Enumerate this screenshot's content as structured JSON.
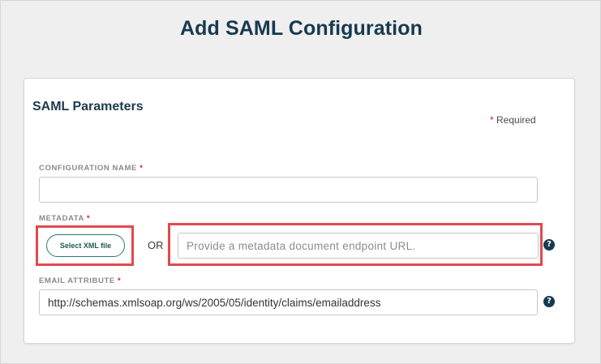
{
  "page": {
    "title": "Add SAML Configuration"
  },
  "card": {
    "section_title": "SAML Parameters",
    "required_note": {
      "star": "*",
      "text": "Required"
    }
  },
  "fields": {
    "configuration_name": {
      "label": "CONFIGURATION NAME",
      "star": "*",
      "value": ""
    },
    "metadata": {
      "label": "METADATA",
      "star": "*",
      "select_button": "Select XML file",
      "or_text": "OR",
      "url_placeholder": "Provide a metadata document endpoint URL.",
      "help_icon": "question-circle-icon"
    },
    "email_attribute": {
      "label": "EMAIL ATTRIBUTE",
      "star": "*",
      "value": "http://schemas.xmlsoap.org/ws/2005/05/identity/claims/emailaddress",
      "help_icon": "question-circle-icon"
    }
  },
  "colors": {
    "title": "#173a4f",
    "highlight": "#e04a50",
    "button_border": "#2a7a6a",
    "help_icon_bg": "#163a52",
    "required_star": "#c62828"
  }
}
